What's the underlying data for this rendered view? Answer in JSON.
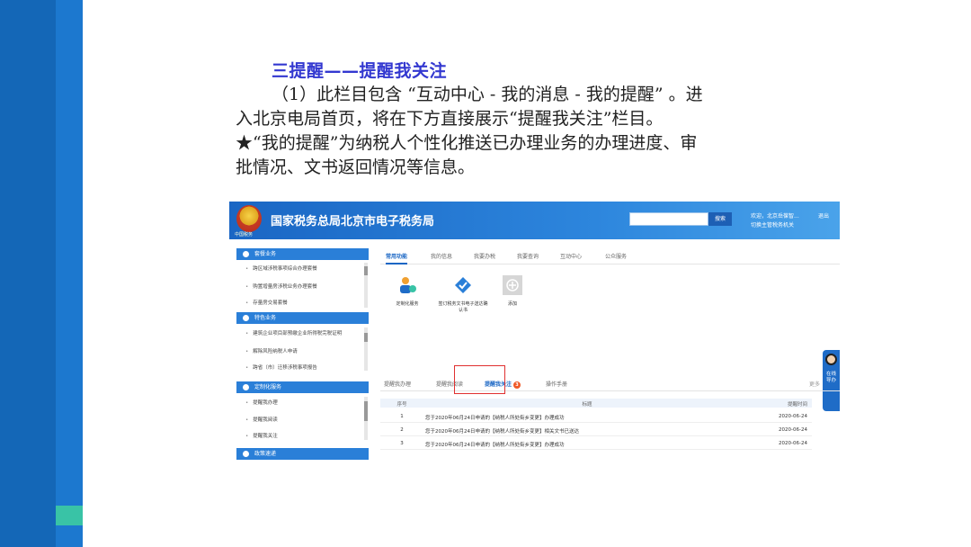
{
  "slide": {
    "title": "三提醒——提醒我关注",
    "paragraph_line1": "（1）此栏目包含 “互动中心 - 我的消息 - 我的提醒” 。进",
    "paragraph_line2": "入北京电局首页，将在下方直接展示“提醒我关注”栏目。",
    "note_line1": "★“我的提醒”为纳税人个性化推送已办理业务的办理进度、审",
    "note_line2": "批情况、文书返回情况等信息。"
  },
  "colors": {
    "brand_blue": "#1a66c4",
    "accent_green": "#39c3a6",
    "title_blue": "#3338d0",
    "badge_orange": "#f05a28",
    "highlight_red": "#e03030"
  },
  "portal": {
    "site_title": "国家税务总局北京市电子税务局",
    "emblem_icon": "tax-emblem-icon",
    "emblem_label": "中国税务",
    "search_placeholder": "",
    "search_button": "搜索",
    "welcome_text": "欢迎，北京岳葆智...",
    "switch_org": "切换主管税务机关",
    "logout": "退出",
    "left_nav": {
      "sections": [
        {
          "label": "套餐业务",
          "items": [
            "跨区域涉税事项综合办理套餐",
            "购置增量房涉税业务办理套餐",
            "存量房交易套餐"
          ]
        },
        {
          "label": "特色业务",
          "items": [
            "建筑企业项目部预缴企业所得税完税证明",
            "解除风险纳税人申请",
            "跨省（市）迁移涉税事项报告"
          ]
        },
        {
          "label": "定制化服务",
          "items": [
            "提醒我办理",
            "提醒我阅读",
            "提醒我关注"
          ]
        },
        {
          "label": "政策速递",
          "items": []
        }
      ]
    },
    "main_tabs": [
      "常用功能",
      "我的信息",
      "我要办税",
      "我要查询",
      "互动中心",
      "公众服务"
    ],
    "functions": [
      {
        "label": "定制化服务",
        "icon": "custom-service-icon"
      },
      {
        "label": "签订税务文书电子送达确认书",
        "icon": "document-check-icon"
      },
      {
        "label": "添加",
        "icon": "add-icon"
      }
    ],
    "lower_tabs": [
      "提醒我办理",
      "提醒我阅读",
      "提醒我关注",
      "操作手册"
    ],
    "lower_active_badge": "3",
    "more_link": "更多",
    "table": {
      "headers": [
        "序号",
        "标题",
        "提醒时间"
      ],
      "rows": [
        {
          "idx": "1",
          "title": "您于2020年06月24日申请的【纳税人所处街乡变更】办理成功",
          "date": "2020-06-24"
        },
        {
          "idx": "2",
          "title": "您于2020年06月24日申请的【纳税人所处街乡变更】相关文书已送达",
          "date": "2020-06-24"
        },
        {
          "idx": "3",
          "title": "您于2020年06月24日申请的【纳税人所处街乡变更】办理成功",
          "date": "2020-06-24"
        }
      ]
    },
    "online_service": "在线导办"
  }
}
